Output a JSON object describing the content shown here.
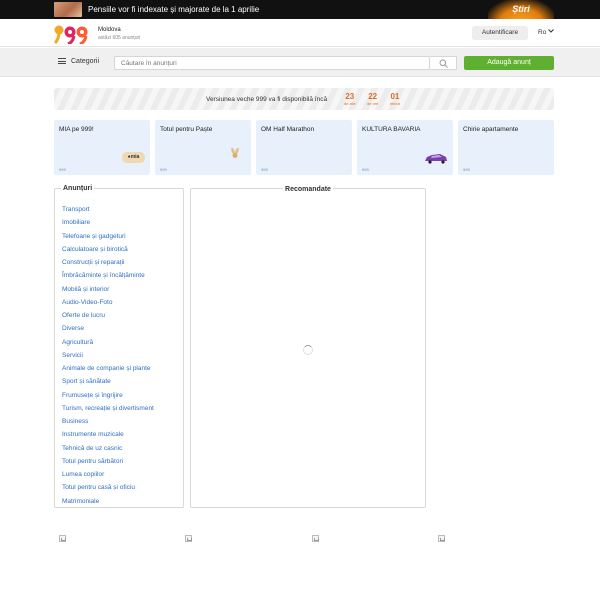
{
  "news": {
    "text": "Pensiile vor fi indexate și majorate de la 1 aprilie",
    "logo": "Știri"
  },
  "header": {
    "site_name": "Moldova",
    "site_sub": "astăzi 605 anunțuri",
    "login_label": "Autentificare",
    "language": "Ro",
    "language_icon": "chevron-down-icon"
  },
  "toolbar": {
    "categories_label": "Categorii",
    "search_placeholder": "Căutare în anunțuri",
    "add_label": "Adaugă anunț"
  },
  "banner": {
    "text": "Versiunea veche 999 va fi disponibilă încă",
    "days": "23",
    "days_label": "de zile",
    "hours": "22",
    "hours_label": "de ore",
    "minutes": "01",
    "minutes_label": "minut"
  },
  "cards": [
    {
      "title": "MIA pe 999!",
      "tag": "999"
    },
    {
      "title": "Totul pentru Paște",
      "tag": "999"
    },
    {
      "title": "OM Half Marathon",
      "tag": "999"
    },
    {
      "title": "KULTURA BAVARIA",
      "tag": "999"
    },
    {
      "title": "Chirie apartamente",
      "tag": "999"
    }
  ],
  "categories": {
    "title": "Anunțuri",
    "items": [
      "Transport",
      "Imobiliare",
      "Telefoane și gadgeturi",
      "Calculatoare și birotică",
      "Construcții și reparații",
      "Îmbrăcăminte și încălțăminte",
      "Mobilă și interior",
      "Audio-Video-Foto",
      "Oferte de lucru",
      "Diverse",
      "Agricultură",
      "Servicii",
      "Animale de companie și plante",
      "Sport și sănătate",
      "Frumusețe și îngrijire",
      "Turism, recreație și divertisment",
      "Business",
      "Instrumente muzicale",
      "Tehnică de uz casnic",
      "Totul pentru sărbători",
      "Lumea copiilor",
      "Totul pentru casă și oficiu",
      "Matrimoniale"
    ]
  },
  "recommended": {
    "title": "Recomandate"
  },
  "colors": {
    "accent_green": "#5fb030",
    "link_blue": "#2f6fc4",
    "countdown_orange": "#e06a1e"
  }
}
